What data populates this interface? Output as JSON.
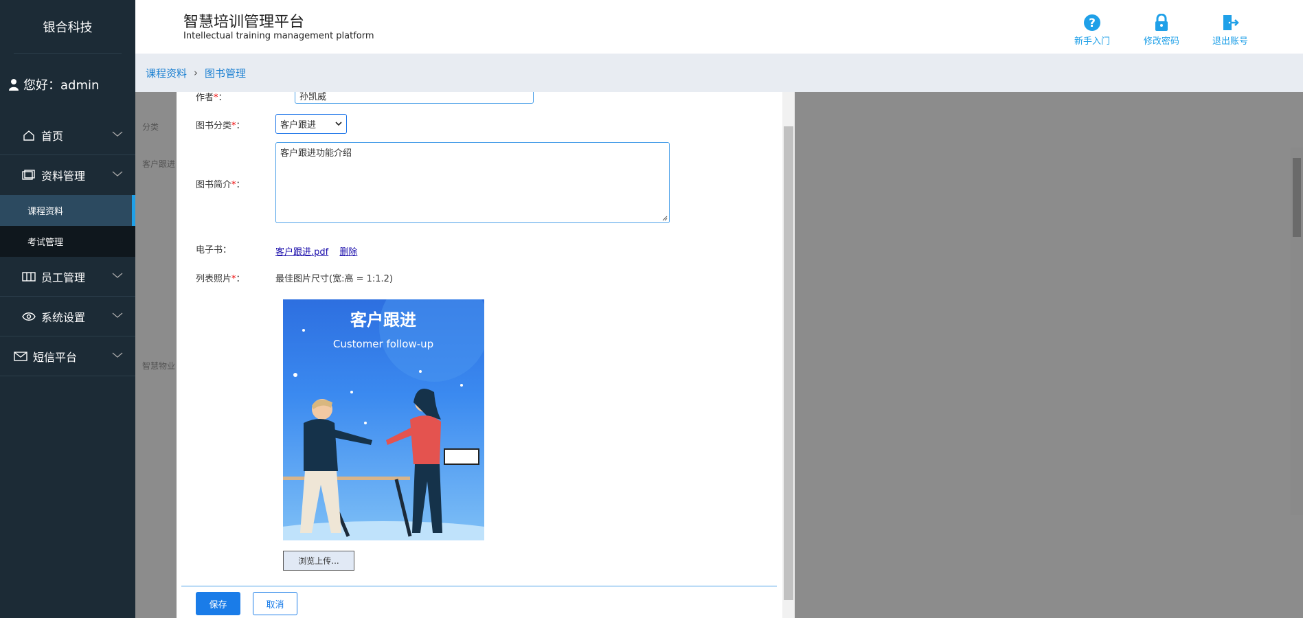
{
  "sidebar": {
    "brand": "银合科技",
    "greeting": "您好：admin",
    "nav": [
      {
        "label": "首页",
        "icon": "home-icon"
      },
      {
        "label": "资料管理",
        "icon": "documents-icon"
      },
      {
        "label": "员工管理",
        "icon": "staff-icon"
      },
      {
        "label": "系统设置",
        "icon": "eye-settings-icon"
      },
      {
        "label": "短信平台",
        "icon": "mail-icon"
      }
    ],
    "sub": [
      "课程资料",
      "考试管理"
    ]
  },
  "header": {
    "title": "智慧培训管理平台",
    "subtitle": "Intellectual training management platform",
    "buttons": [
      "新手入门",
      "修改密码",
      "退出账号"
    ],
    "accent": "#1fa0e8"
  },
  "breadcrumb": {
    "items": [
      "课程资料",
      "图书管理"
    ]
  },
  "background": {
    "col_label": "分类",
    "row1": "客户跟进",
    "row2": "智慧物业"
  },
  "form": {
    "author_label": "作者",
    "author_value": "孙凯威",
    "category_label": "图书分类",
    "category_value": "客户跟进",
    "intro_label": "图书简介",
    "intro_value": "客户跟进功能介绍",
    "ebook_label": "电子书：",
    "ebook_file": "客户跟进.pdf",
    "ebook_delete": "删除",
    "photo_label": "列表照片",
    "photo_hint": "最佳图片尺寸(宽:高 = 1:1.2)",
    "cover_title": "客户跟进",
    "cover_subtitle": "Customer follow-up",
    "browse": "浏览上传...",
    "save": "保存",
    "cancel": "取消"
  }
}
